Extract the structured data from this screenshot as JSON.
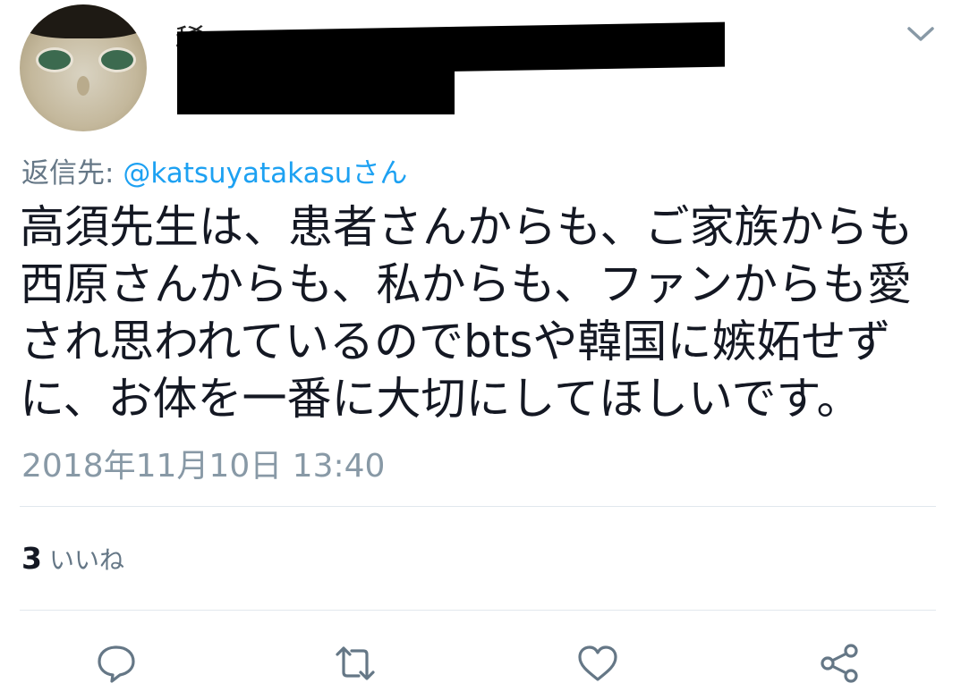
{
  "user": {
    "display_name": "稀",
    "handle": "@"
  },
  "tweet": {
    "reply_prefix": "返信先: ",
    "reply_mention": "@katsuyatakasuさん",
    "lines": [
      "高須先生は、患者さんからも、ご家族からも",
      "西原さんからも、私からも、ファンからも愛",
      "され思われているのでbtsや韓国に嫉妬せず",
      "に、お体を一番に大切にしてほしいです。"
    ],
    "timestamp": "2018年11月10日 13:40"
  },
  "stats": {
    "like_count": "3",
    "like_label": "いいね"
  },
  "actions": [
    "reply-icon",
    "retweet-icon",
    "like-icon",
    "share-icon"
  ],
  "colors": {
    "mention": "#1da1f2",
    "secondary": "#657786",
    "icon": "#657786",
    "separator": "#e1e8ed"
  }
}
